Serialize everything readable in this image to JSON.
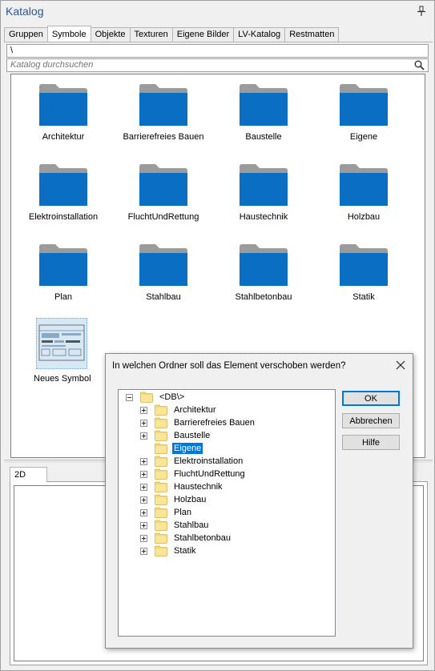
{
  "window": {
    "title": "Katalog"
  },
  "tabs": [
    "Gruppen",
    "Symbole",
    "Objekte",
    "Texturen",
    "Eigene Bilder",
    "LV-Katalog",
    "Restmatten"
  ],
  "active_tab": "Symbole",
  "path": "\\",
  "search": {
    "placeholder": "Katalog durchsuchen"
  },
  "folders": [
    "Architektur",
    "Barrierefreies Bauen",
    "Baustelle",
    "Eigene",
    "Elektroinstallation",
    "FluchtUndRettung",
    "Haustechnik",
    "Holzbau",
    "Plan",
    "Stahlbau",
    "Stahlbetonbau",
    "Statik"
  ],
  "symbol": {
    "label": "Neues Symbol"
  },
  "preview_tab": "2D",
  "colors": {
    "folder_body": "#0a6fc2",
    "folder_tab": "#9b9b9b",
    "selection": "#0078d7",
    "title": "#2b5797"
  },
  "dialog": {
    "title": "In welchen Ordner soll das Element verschoben werden?",
    "root": "<DB\\>",
    "items": [
      {
        "label": "Architektur",
        "expandable": true
      },
      {
        "label": "Barrierefreies Bauen",
        "expandable": true
      },
      {
        "label": "Baustelle",
        "expandable": true
      },
      {
        "label": "Eigene",
        "expandable": false,
        "selected": true
      },
      {
        "label": "Elektroinstallation",
        "expandable": true
      },
      {
        "label": "FluchtUndRettung",
        "expandable": true
      },
      {
        "label": "Haustechnik",
        "expandable": true
      },
      {
        "label": "Holzbau",
        "expandable": true
      },
      {
        "label": "Plan",
        "expandable": true
      },
      {
        "label": "Stahlbau",
        "expandable": true
      },
      {
        "label": "Stahlbetonbau",
        "expandable": true
      },
      {
        "label": "Statik",
        "expandable": true
      }
    ],
    "buttons": {
      "ok": "OK",
      "cancel": "Abbrechen",
      "help": "Hilfe"
    }
  }
}
